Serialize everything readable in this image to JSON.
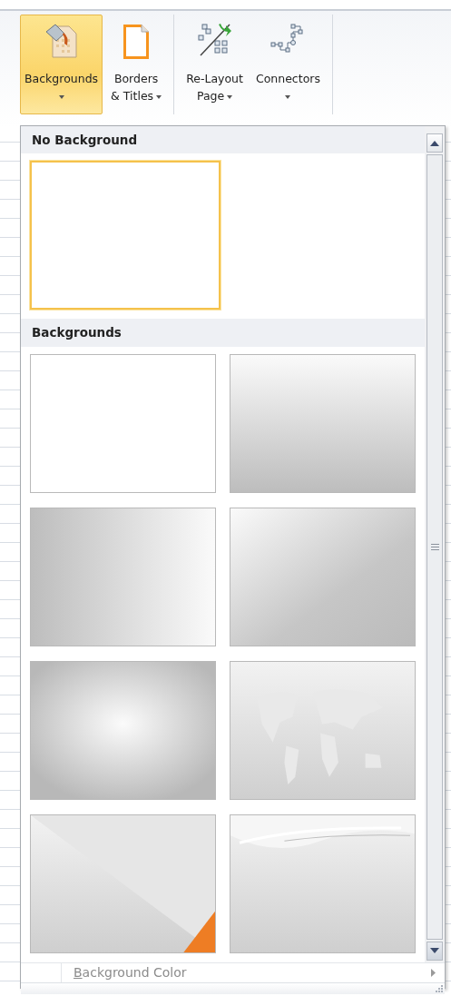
{
  "ribbon": {
    "groups": [
      {
        "buttons": [
          {
            "kind": "backgrounds",
            "lines": [
              "Backgrounds"
            ],
            "dropdown": true,
            "selected": true
          },
          {
            "kind": "borders",
            "lines": [
              "Borders",
              "& Titles"
            ],
            "dropdown": true,
            "selected": false
          }
        ]
      },
      {
        "buttons": [
          {
            "kind": "relayout",
            "lines": [
              "Re-Layout",
              "Page"
            ],
            "dropdown": true,
            "selected": false
          },
          {
            "kind": "connectors",
            "lines": [
              "Connectors"
            ],
            "dropdown": true,
            "selected": false
          }
        ]
      }
    ]
  },
  "gallery": {
    "sections": [
      {
        "title": "No Background",
        "items": [
          {
            "kind": "blank",
            "selected": true
          }
        ]
      },
      {
        "title": "Backgrounds",
        "items": [
          {
            "kind": "blank",
            "selected": false
          },
          {
            "kind": "vertical",
            "selected": false
          },
          {
            "kind": "horizontal",
            "selected": false
          },
          {
            "kind": "diagonal",
            "selected": false
          },
          {
            "kind": "radial",
            "selected": false
          },
          {
            "kind": "map",
            "selected": false
          },
          {
            "kind": "corner",
            "selected": false
          },
          {
            "kind": "wave",
            "selected": false
          }
        ]
      }
    ]
  },
  "menu_item": {
    "label": "Background Color",
    "submenu": true,
    "disabled": true
  }
}
